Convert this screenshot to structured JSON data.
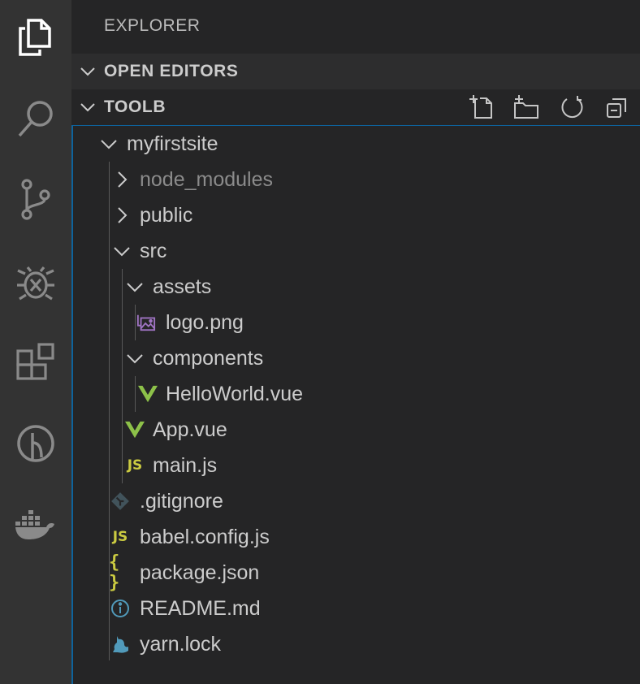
{
  "activity_bar": {
    "items": [
      {
        "name": "explorer",
        "icon": "files-icon",
        "active": true
      },
      {
        "name": "search",
        "icon": "search-icon"
      },
      {
        "name": "source-control",
        "icon": "source-control-icon"
      },
      {
        "name": "debug",
        "icon": "debug-icon"
      },
      {
        "name": "extensions",
        "icon": "extensions-icon"
      },
      {
        "name": "gitlens",
        "icon": "gitlens-icon"
      },
      {
        "name": "docker",
        "icon": "docker-icon"
      }
    ]
  },
  "sidebar": {
    "title": "EXPLORER",
    "sections": {
      "open_editors": "OPEN EDITORS",
      "workspace": "TOOLB"
    },
    "actions": [
      "new-file-icon",
      "new-folder-icon",
      "refresh-icon",
      "collapse-all-icon"
    ]
  },
  "tree": {
    "root": "myfirstsite",
    "node_modules": "node_modules",
    "public": "public",
    "src": "src",
    "assets": "assets",
    "logo": "logo.png",
    "components": "components",
    "helloworld": "HelloWorld.vue",
    "app": "App.vue",
    "main": "main.js",
    "gitignore": ".gitignore",
    "babel": "babel.config.js",
    "package": "package.json",
    "readme": "README.md",
    "yarn": "yarn.lock"
  },
  "icon_glyphs": {
    "js": "JS",
    "json": "{ }"
  },
  "colors": {
    "vue": "#8dc149",
    "js": "#cbcb41",
    "image": "#a074c4",
    "info": "#519aba",
    "focus_border": "#0e639c"
  }
}
